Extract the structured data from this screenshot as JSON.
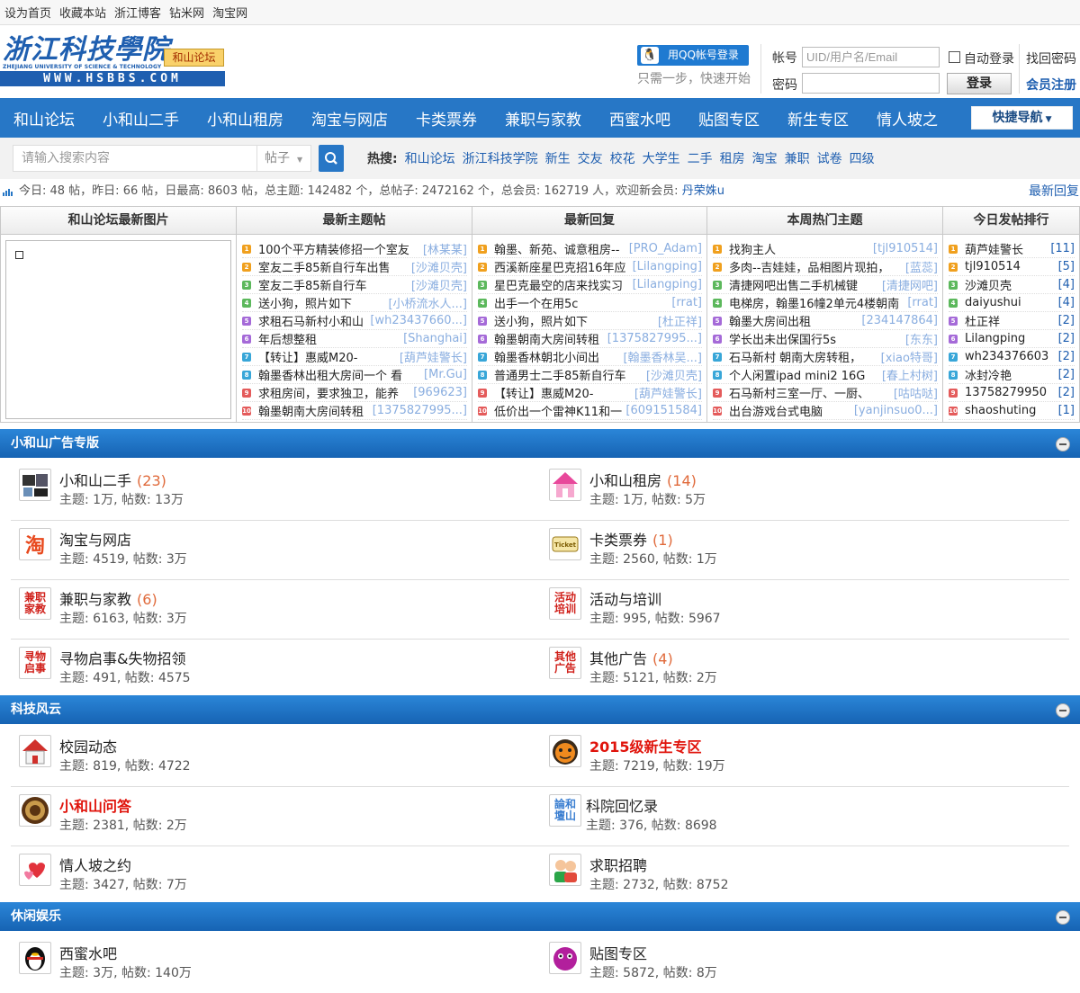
{
  "topbar": [
    "设为首页",
    "收藏本站",
    "浙江博客",
    "钻米网",
    "淘宝网"
  ],
  "logo": {
    "cn": "浙江科技學院",
    "en_small": "ZHEJIANG UNIVERSITY OF SCIENCE & TECHNOLOGY",
    "en": "WWW.HSBBS.COM",
    "tag": "和山论坛"
  },
  "login": {
    "qq_button": "用QQ帐号登录",
    "qq_tip": "只需一步，快速开始",
    "account_label": "帐号",
    "account_placeholder": "UID/用户名/Email",
    "password_label": "密码",
    "auto_login": "自动登录",
    "login_button": "登录",
    "find_password": "找回密码",
    "register": "会员注册"
  },
  "nav": [
    "和山论坛",
    "小和山二手",
    "小和山租房",
    "淘宝与网店",
    "卡类票券",
    "兼职与家教",
    "西蜜水吧",
    "贴图专区",
    "新生专区",
    "情人坡之"
  ],
  "quick_nav": "快捷导航",
  "search": {
    "placeholder": "请输入搜索内容",
    "type": "帖子",
    "hot_label": "热搜:",
    "hot_words": [
      "和山论坛",
      "浙江科技学院",
      "新生",
      "交友",
      "校花",
      "大学生",
      "二手",
      "租房",
      "淘宝",
      "兼职",
      "试卷",
      "四级"
    ]
  },
  "stats": {
    "text": "今日: 48 帖，昨日: 66 帖，日最高: 8603 帖，总主题: 142482 个，总帖子: 2472162 个，总会员: 162719 人，欢迎新会员: ",
    "new_member": "丹荣姝u",
    "latest_reply_link": "最新回复"
  },
  "grid": {
    "headers": [
      "和山论坛最新图片",
      "最新主题帖",
      "最新回复",
      "本周热门主题",
      "今日发帖排行"
    ],
    "rank_colors": [
      "#f0a01e",
      "#f0a01e",
      "#5cb85c",
      "#5cb85c",
      "#a56ad8",
      "#a56ad8",
      "#38a6d8",
      "#38a6d8",
      "#e45b5b",
      "#e45b5b"
    ],
    "rank_labels": [
      "1",
      "2",
      "3",
      "4",
      "5",
      "6",
      "7",
      "8",
      "9",
      "10"
    ],
    "new_threads": [
      {
        "t": "100个平方精装修招一个室友",
        "a": "[林某某]"
      },
      {
        "t": "室友二手85新自行车出售",
        "a": "[沙滩贝壳]"
      },
      {
        "t": "室友二手85新自行车",
        "a": "[沙滩贝壳]"
      },
      {
        "t": "送小狗，照片如下",
        "a": "[小桥流水人...]"
      },
      {
        "t": "求租石马新村小和山",
        "a": "[wh23437660...]"
      },
      {
        "t": "年后想整租",
        "a": "[Shanghai]"
      },
      {
        "t": "【转让】惠威M20-",
        "a": "[葫芦娃警长]"
      },
      {
        "t": "翰墨香林出租大房间一个  看",
        "a": "[Mr.Gu]"
      },
      {
        "t": "求租房间，要求独卫，能养",
        "a": "[969623]"
      },
      {
        "t": "翰墨朝南大房间转租",
        "a": "[1375827995...]"
      }
    ],
    "new_replies": [
      {
        "t": "翰墨、新苑、诚意租房--",
        "a": "[PRO_Adam]"
      },
      {
        "t": "西溪新座星巴克招16年应",
        "a": "[Lilangping]"
      },
      {
        "t": "星巴克最空的店来找实习",
        "a": "[Lilangping]"
      },
      {
        "t": "出手一个在用5c",
        "a": "[rrat]"
      },
      {
        "t": "送小狗，照片如下",
        "a": "[杜正祥]"
      },
      {
        "t": "翰墨朝南大房间转租",
        "a": "[1375827995...]"
      },
      {
        "t": "翰墨香林朝北小间出",
        "a": "[翰墨香林吴...]"
      },
      {
        "t": "普通男士二手85新自行车",
        "a": "[沙滩贝壳]"
      },
      {
        "t": "【转让】惠威M20-",
        "a": "[葫芦娃警长]"
      },
      {
        "t": "低价出一个雷神K11和一",
        "a": "[609151584]"
      }
    ],
    "weekly_hot": [
      {
        "t": "找狗主人",
        "a": "[tjl910514]"
      },
      {
        "t": "多肉--吉娃娃，品相图片现拍，",
        "a": "[蓝蕊]"
      },
      {
        "t": "清捷网吧出售二手机械键",
        "a": "[清捷网吧]"
      },
      {
        "t": "电梯房，翰墨16幢2单元4楼朝南",
        "a": "[rrat]"
      },
      {
        "t": "翰墨大房间出租",
        "a": "[234147864]"
      },
      {
        "t": "学长出未出保国行5s",
        "a": "[东东]"
      },
      {
        "t": "石马新村 朝南大房转租，",
        "a": "[xiao特哥]"
      },
      {
        "t": "个人闲置ipad mini2 16G",
        "a": "[春上村树]"
      },
      {
        "t": "石马新村三室一厅、一厨、",
        "a": "[咕咕哒]"
      },
      {
        "t": "出台游戏台式电脑",
        "a": "[yanjinsuo0...]"
      }
    ],
    "ranking": [
      {
        "t": "葫芦娃警长",
        "c": "[11]"
      },
      {
        "t": "tjl910514",
        "c": "[5]"
      },
      {
        "t": "沙滩贝壳",
        "c": "[4]"
      },
      {
        "t": "daiyushui",
        "c": "[4]"
      },
      {
        "t": "杜正祥",
        "c": "[2]"
      },
      {
        "t": "Lilangping",
        "c": "[2]"
      },
      {
        "t": "wh234376603",
        "c": "[2]"
      },
      {
        "t": "冰封冷艳",
        "c": "[2]"
      },
      {
        "t": "13758279950",
        "c": "[2]"
      },
      {
        "t": "shaoshuting",
        "c": "[1]"
      }
    ]
  },
  "sections": [
    {
      "title": "小和山广告专版",
      "forums": [
        {
          "name": "小和山二手",
          "count": "(23)",
          "stat": "主题: 1万, 帖数: 13万",
          "icon": "second-hand-icon"
        },
        {
          "name": "小和山租房",
          "count": "(14)",
          "stat": "主题: 1万, 帖数: 5万",
          "icon": "house-icon"
        },
        {
          "name": "淘宝与网店",
          "count": "",
          "stat": "主题: 4519, 帖数: 3万",
          "icon": "taobao-icon",
          "glyph": "淘"
        },
        {
          "name": "卡类票券",
          "count": "(1)",
          "stat": "主题: 2560, 帖数: 1万",
          "icon": "ticket-icon"
        },
        {
          "name": "兼职与家教",
          "count": "(6)",
          "stat": "主题: 6163, 帖数: 3万",
          "icon": "job-icon",
          "glyph": "兼职家教"
        },
        {
          "name": "活动与培训",
          "count": "",
          "stat": "主题: 995, 帖数: 5967",
          "icon": "activity-icon",
          "glyph": "活动培训"
        },
        {
          "name": "寻物启事&失物招领",
          "count": "",
          "stat": "主题: 491, 帖数: 4575",
          "icon": "lost-found-icon",
          "glyph": "寻物启事"
        },
        {
          "name": "其他广告",
          "count": "(4)",
          "stat": "主题: 5121, 帖数: 2万",
          "icon": "other-ad-icon",
          "glyph": "其他广告"
        }
      ]
    },
    {
      "title": "科技风云",
      "forums": [
        {
          "name": "校园动态",
          "count": "",
          "stat": "主题: 819, 帖数: 4722",
          "icon": "campus-icon"
        },
        {
          "name": "2015级新生专区",
          "count": "",
          "stat": "主题: 7219, 帖数: 19万",
          "icon": "freshman-icon",
          "highlight": true
        },
        {
          "name": "小和山问答",
          "count": "",
          "stat": "主题: 2381, 帖数: 2万",
          "icon": "qa-icon",
          "highlight": true
        },
        {
          "name": "科院回忆录",
          "count": "",
          "stat": "主题: 376, 帖数: 8698",
          "icon": "memoir-icon",
          "glyph": "論和壇山"
        },
        {
          "name": "情人坡之约",
          "count": "",
          "stat": "主题: 3427, 帖数: 7万",
          "icon": "love-icon"
        },
        {
          "name": "求职招聘",
          "count": "",
          "stat": "主题: 2732, 帖数: 8752",
          "icon": "recruit-icon"
        }
      ]
    },
    {
      "title": "休闲娱乐",
      "forums": [
        {
          "name": "西蜜水吧",
          "count": "",
          "stat": "主题: 3万, 帖数: 140万",
          "icon": "qq-penguin-icon"
        },
        {
          "name": "贴图专区",
          "count": "",
          "stat": "主题: 5872, 帖数: 8万",
          "icon": "photo-icon"
        }
      ]
    }
  ]
}
